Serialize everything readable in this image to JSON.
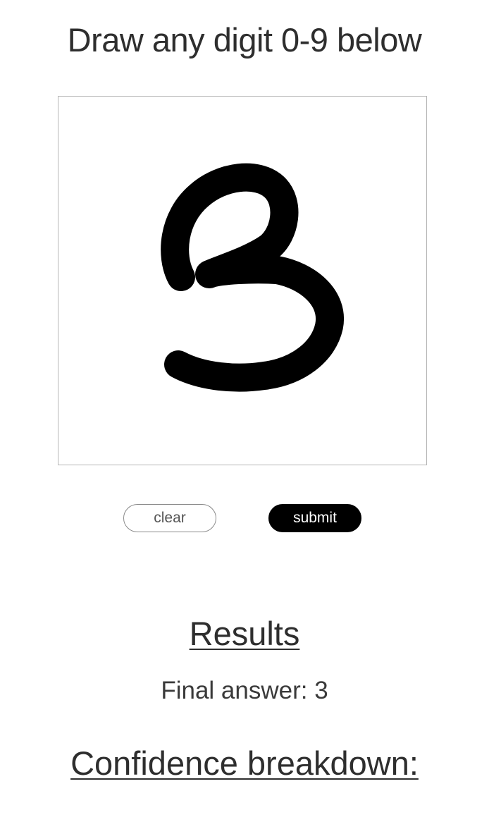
{
  "page": {
    "title": "Draw any digit 0-9 below"
  },
  "canvas": {
    "drawn_digit": "3",
    "stroke_color": "#000000",
    "background_color": "#ffffff",
    "border_color": "#b5b5b5"
  },
  "controls": {
    "clear_label": "clear",
    "submit_label": "submit",
    "submit_bg_color": "#000000",
    "submit_text_color": "#ffffff"
  },
  "results": {
    "heading": "Results",
    "final_answer": "Final answer: 3",
    "confidence_heading": "Confidence breakdown:"
  }
}
